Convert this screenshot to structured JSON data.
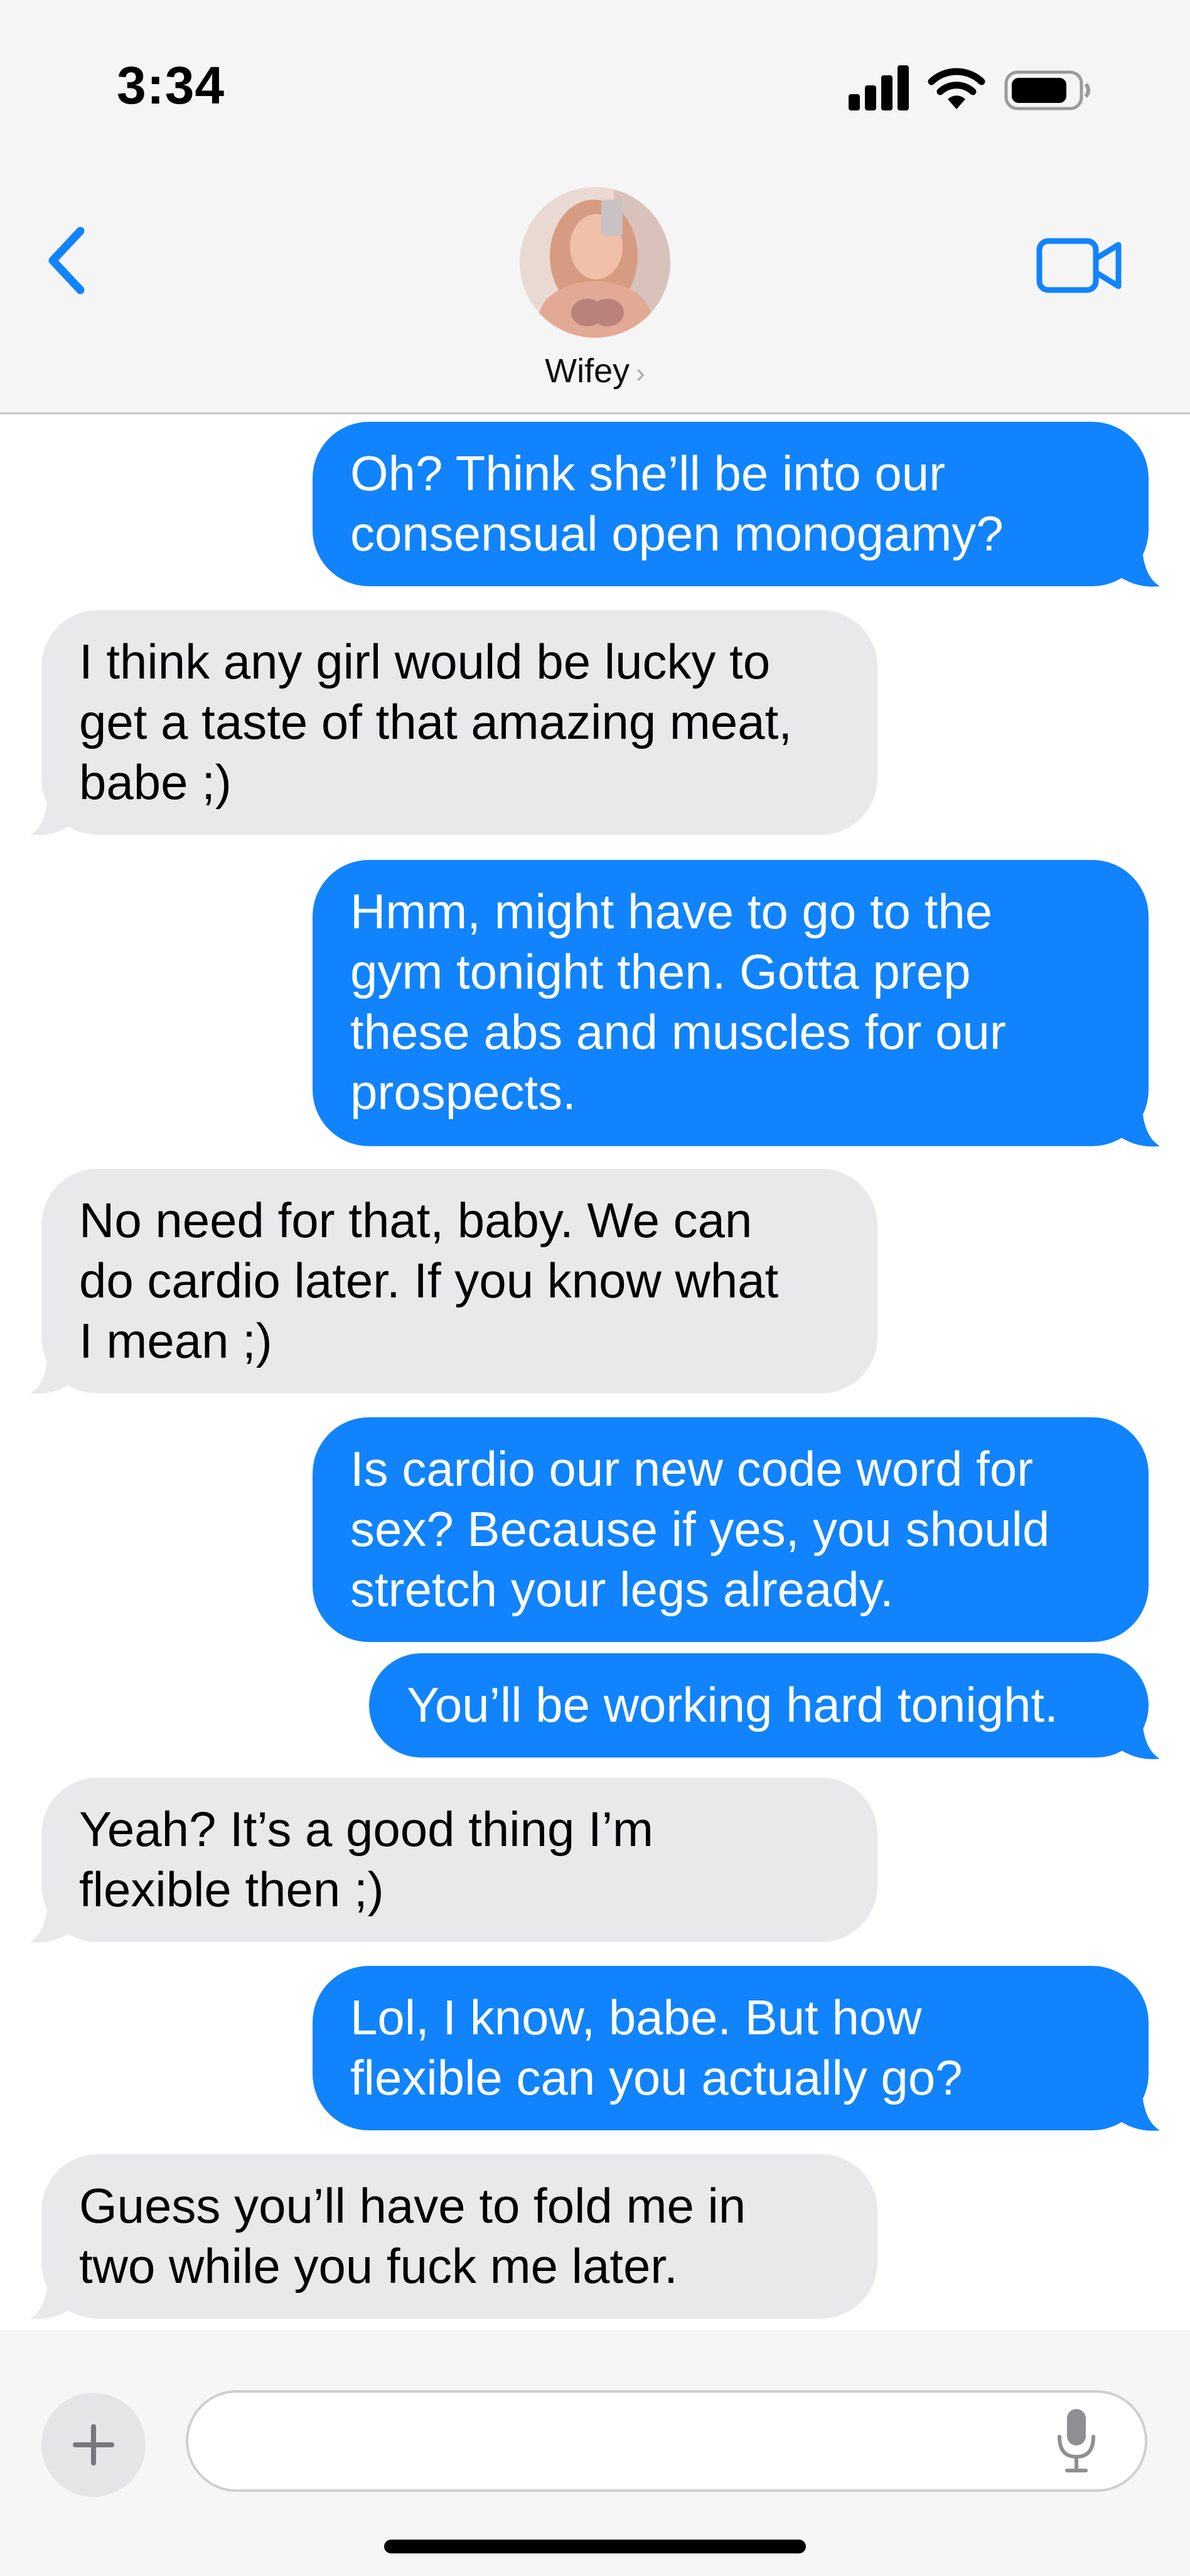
{
  "status_bar": {
    "time": "3:34",
    "battery_level": 0.85
  },
  "header": {
    "contact_name": "Wifey",
    "accent_color": "#1083fd",
    "icons": [
      "back-chevron-icon",
      "contact-avatar",
      "facetime-video-icon"
    ]
  },
  "messages": [
    {
      "from": "me",
      "text": "Oh? Think she’ll be into our\nconsensual open monogamy?"
    },
    {
      "from": "them",
      "text": "I think any girl would be lucky to\nget a taste of that amazing meat,\nbabe ;)"
    },
    {
      "from": "me",
      "text": "Hmm, might have to go to the\ngym tonight then. Gotta prep\nthese abs and muscles for our\nprospects."
    },
    {
      "from": "them",
      "text": "No need for that, baby. We can\ndo cardio later. If you know what\nI mean ;)"
    },
    {
      "from": "me",
      "text": "Is cardio our new code word for\nsex? Because if yes, you should\nstretch your legs already."
    },
    {
      "from": "me",
      "text": "You’ll be working hard tonight."
    },
    {
      "from": "them",
      "text": "Yeah? It’s a good thing I’m\nflexible then ;)"
    },
    {
      "from": "me",
      "text": "Lol, I know, babe. But how\nflexible can you actually go?"
    },
    {
      "from": "them",
      "text": "Guess you’ll have to fold me in\ntwo while you fuck me later."
    }
  ],
  "colors": {
    "sent_bubble": "#1083fd",
    "received_bubble": "#e9e9eb"
  },
  "input_bar": {
    "icons": [
      "plus-icon",
      "microphone-icon"
    ]
  }
}
